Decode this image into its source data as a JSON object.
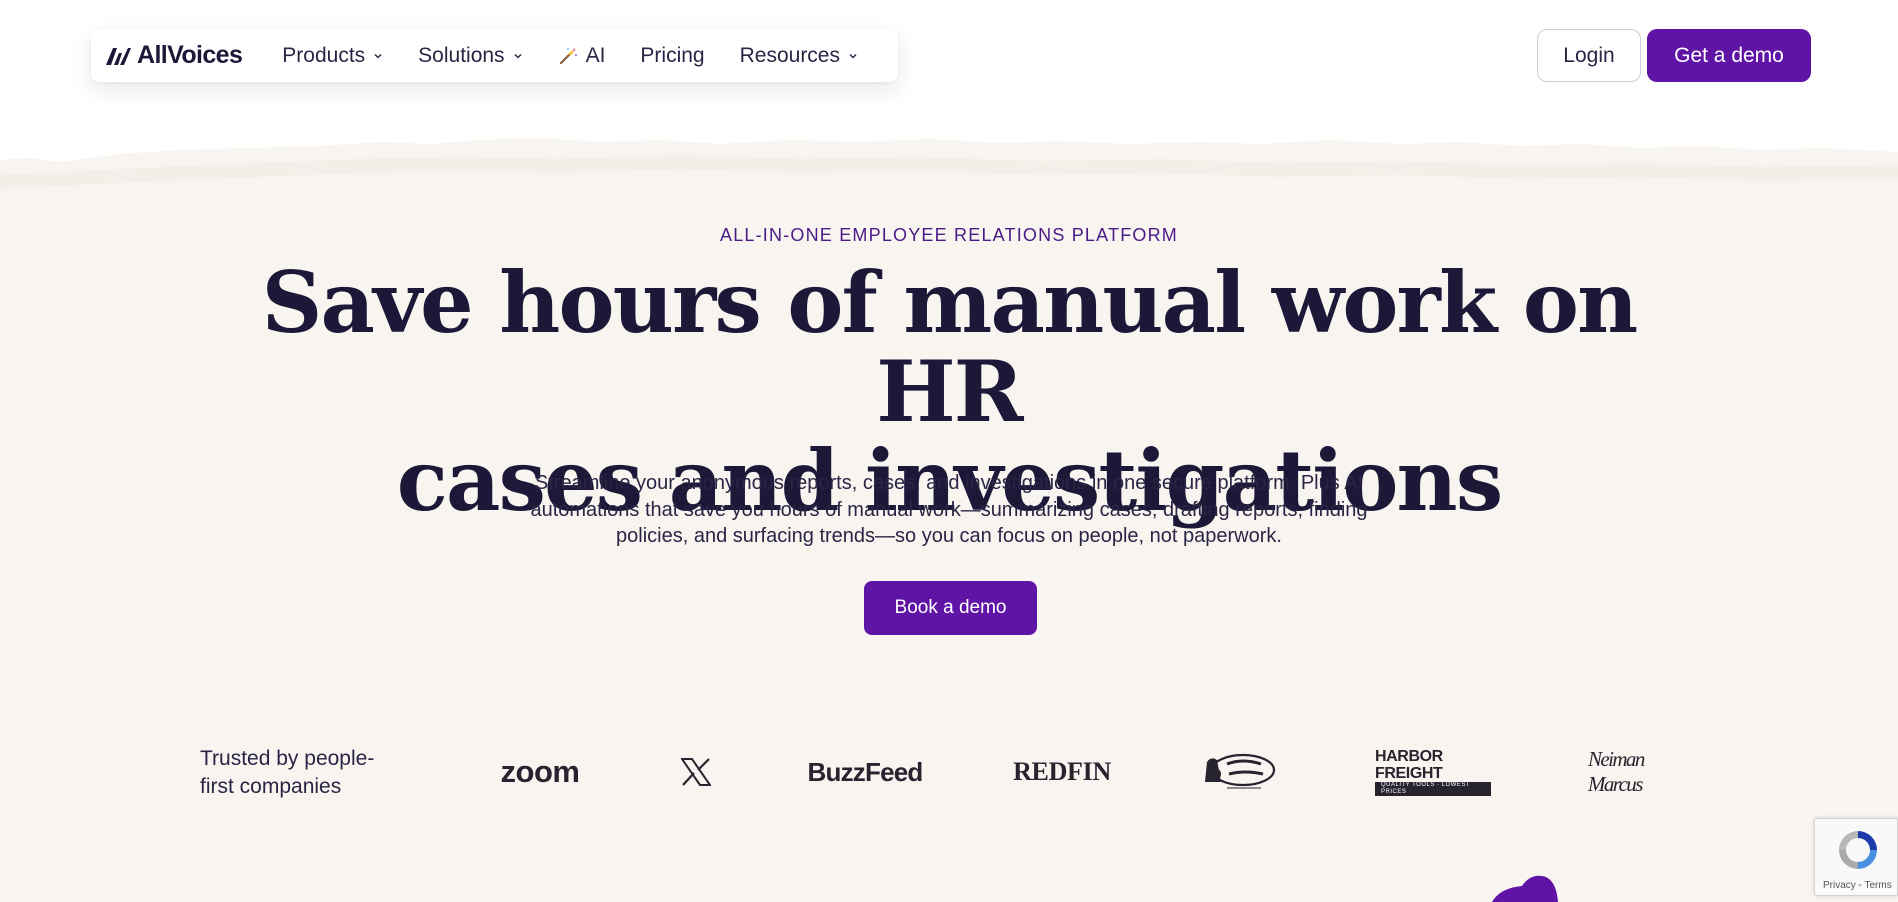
{
  "header": {
    "logo_text": "AllVoices",
    "nav": [
      {
        "label": "Products",
        "has_dropdown": true
      },
      {
        "label": "Solutions",
        "has_dropdown": true
      },
      {
        "label": "AI",
        "icon": "magic-wand-icon"
      },
      {
        "label": "Pricing"
      },
      {
        "label": "Resources",
        "has_dropdown": true
      }
    ],
    "login_label": "Login",
    "demo_label": "Get a demo"
  },
  "hero": {
    "eyebrow": "ALL-IN-ONE EMPLOYEE RELATIONS PLATFORM",
    "headline_line1": "Save hours of manual work on HR",
    "headline_line2": "cases and investigations",
    "subcopy_line1": "Streamline your anonymous reports, cases, and investigations in one secure platform. Plus AI",
    "subcopy_line2": "automations that save you hours of manual work—summarizing cases, drafting reports, finding",
    "subcopy_line3": "policies, and surfacing trends—so you can focus on people, not paperwork.",
    "cta_label": "Book a demo"
  },
  "trusted": {
    "label_line1": "Trusted by people-",
    "label_line2": "first companies",
    "logos": {
      "zoom": "zoom",
      "x": "X",
      "buzzfeed": "BuzzFeed",
      "redfin": "REDFIN",
      "cracker_barrel": "Cracker Barrel",
      "harbor_top": "HARBOR FREIGHT",
      "harbor_bottom": "QUALITY TOOLS · LOWEST PRICES",
      "neiman": "Neiman Marcus"
    }
  },
  "recaptcha": {
    "links": "Privacy - Terms"
  },
  "colors": {
    "brand_purple": "#5f14a6",
    "hero_bg": "#f8f4ef",
    "text_dark": "#1c1838",
    "eyebrow": "#4a1a86"
  }
}
